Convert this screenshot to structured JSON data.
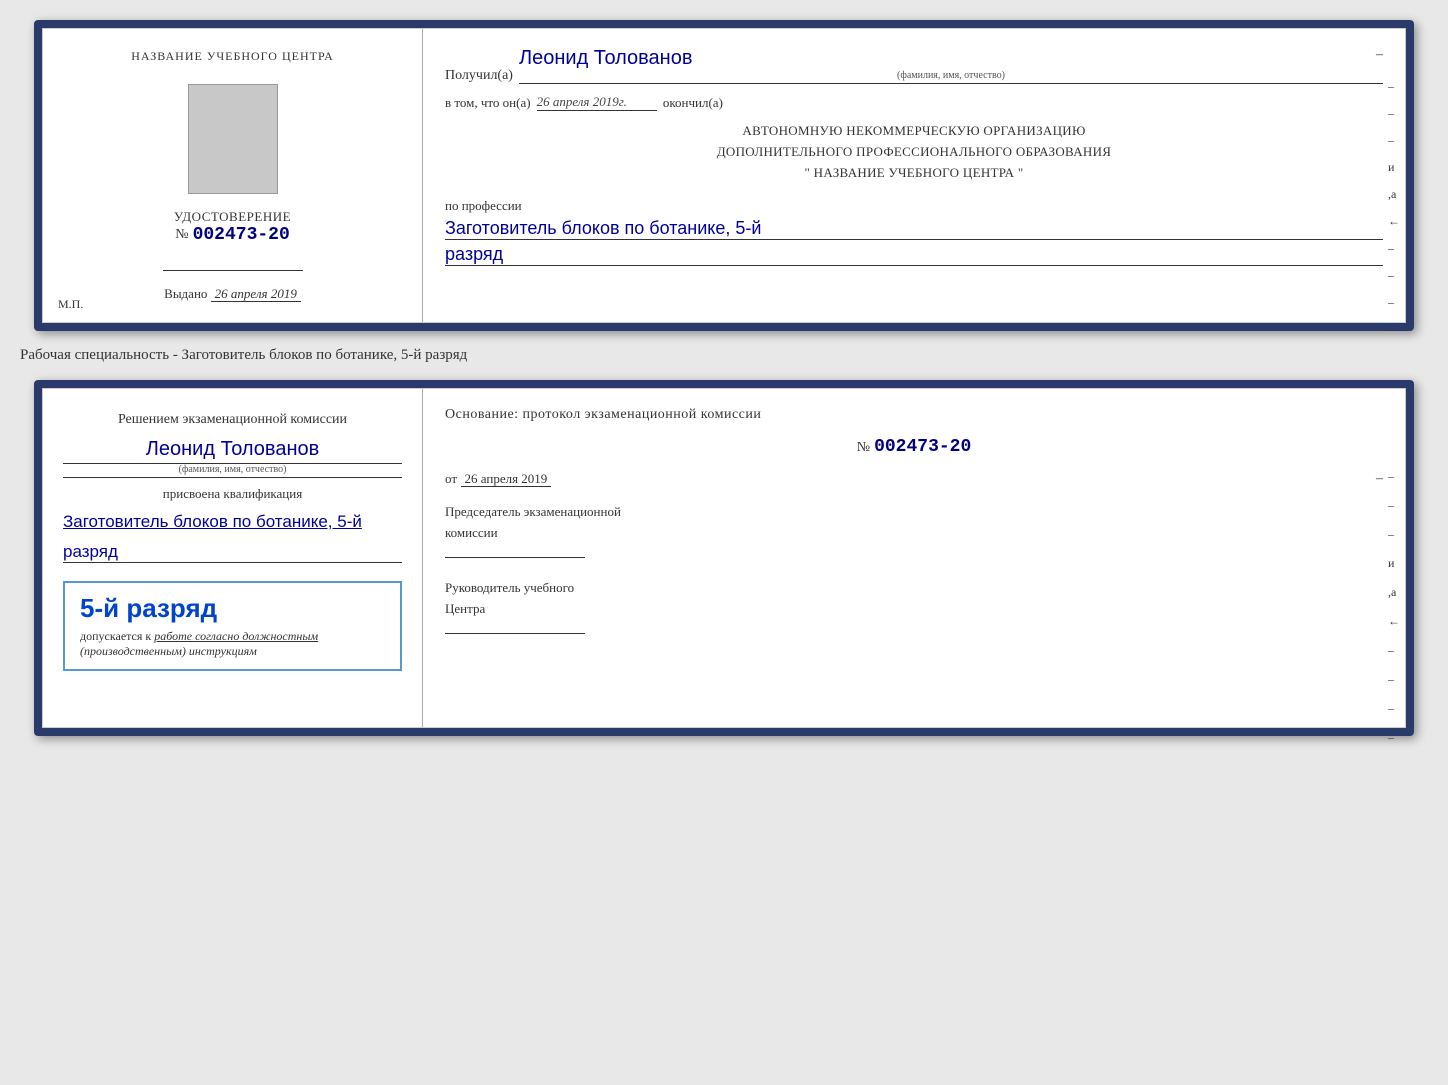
{
  "cert1": {
    "left": {
      "title": "НАЗВАНИЕ УЧЕБНОГО ЦЕНТРА",
      "photo_alt": "Фото",
      "doc_type_label": "УДОСТОВЕРЕНИЕ",
      "number_prefix": "№",
      "number_value": "002473-20",
      "issued_prefix": "Выдано",
      "issued_date": "26 апреля 2019",
      "mp_label": "М.П."
    },
    "right": {
      "recipient_prefix": "Получил(а)",
      "recipient_name": "Леонид Толованов",
      "fio_sublabel": "(фамилия, имя, отчество)",
      "date_prefix": "в том, что он(а)",
      "date_value": "26 апреля 2019г.",
      "date_suffix": "окончил(а)",
      "org_line1": "АВТОНОМНУЮ НЕКОММЕРЧЕСКУЮ ОРГАНИЗАЦИЮ",
      "org_line2": "ДОПОЛНИТЕЛЬНОГО ПРОФЕССИОНАЛЬНОГО ОБРАЗОВАНИЯ",
      "org_line3": "\"  НАЗВАНИЕ УЧЕБНОГО ЦЕНТРА  \"",
      "profession_label": "по профессии",
      "profession_value": "Заготовитель блоков по ботанике, 5-й",
      "rank_value": "разряд",
      "side_marks": [
        "–",
        "–",
        "–",
        "и",
        ",а",
        "←",
        "–",
        "–",
        "–",
        "–"
      ]
    }
  },
  "separator": {
    "text": "Рабочая специальность - Заготовитель блоков по ботанике, 5-й разряд"
  },
  "cert2": {
    "left": {
      "commission_text": "Решением экзаменационной комиссии",
      "person_name": "Леонид Толованов",
      "fio_sublabel": "(фамилия, имя, отчество)",
      "assigned_label": "присвоена квалификация",
      "profession_value": "Заготовитель блоков по ботанике, 5-й",
      "rank_value": "разряд",
      "rank_big": "5-й разряд",
      "допускается_prefix": "допускается к",
      "допускается_text": "работе согласно должностным",
      "инструкциям_text": "(производственным) инструкциям"
    },
    "right": {
      "basis_label": "Основание: протокол экзаменационной комиссии",
      "number_prefix": "№",
      "number_value": "002473-20",
      "from_prefix": "от",
      "from_date": "26 апреля 2019",
      "chairman_label": "Председатель экзаменационной",
      "chairman_label2": "комиссии",
      "head_label1": "Руководитель учебного",
      "head_label2": "Центра",
      "side_marks": [
        "–",
        "–",
        "–",
        "и",
        ",а",
        "←",
        "–",
        "–",
        "–",
        "–"
      ]
    }
  }
}
